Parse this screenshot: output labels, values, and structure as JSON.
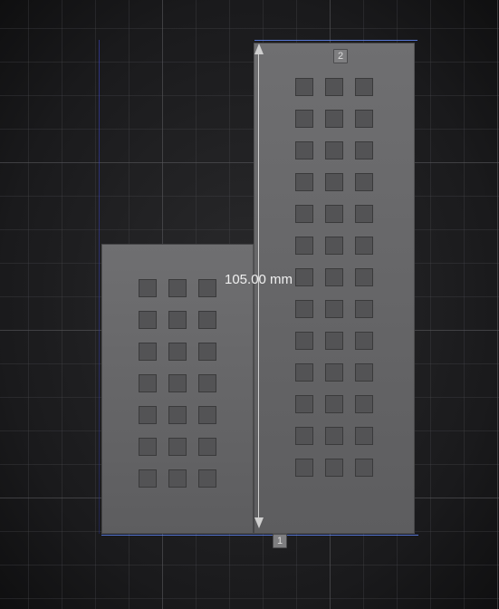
{
  "viewport": {
    "dimension_label": "105.00 mm",
    "endpoint_top": "2",
    "endpoint_bottom": "1"
  },
  "model": {
    "building_left": {
      "window_rows": 7,
      "window_cols": 3
    },
    "building_right": {
      "window_rows": 13,
      "window_cols": 3
    }
  }
}
